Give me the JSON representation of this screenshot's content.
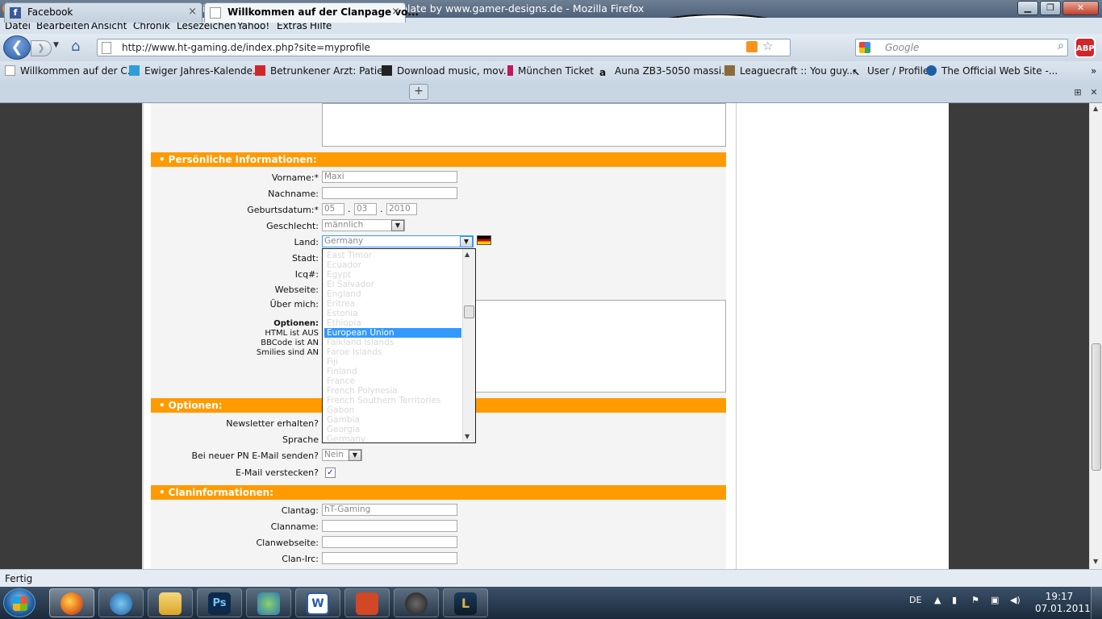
{
  "window": {
    "title": "Willkommen auf der Clanpage von High Times - Konto bearbeiten - ClanTemplate by www.gamer-designs.de - Mozilla Firefox",
    "min": "0",
    "max": "1",
    "close": "r"
  },
  "menu": [
    "Datei",
    "Bearbeiten",
    "Ansicht",
    "Chronik",
    "Lesezeichen",
    "Yahoo!",
    "Extras",
    "Hilfe"
  ],
  "nav": {
    "url": "http://www.ht-gaming.de/index.php?site=myprofile",
    "search_placeholder": "Google",
    "abp_label": "ABP"
  },
  "bookmarks": [
    "Willkommen auf der C...",
    "Ewiger Jahres-Kalende...",
    "Betrunkener Arzt: Patie...",
    "Download music, mov...",
    "München Ticket",
    "Auna ZB3-5050 massi...",
    "Leaguecraft :: You guy...",
    "User / Profile",
    "The Official Web Site -..."
  ],
  "tabs": [
    {
      "label": "Facebook",
      "close": "×"
    },
    {
      "label": "Willkommen auf der Clanpage vo...",
      "close": "×"
    }
  ],
  "newtab": "+",
  "form": {
    "sections": {
      "personal": "Persönliche Informationen:",
      "options": "Optionen:",
      "clan": "Claninformationen:"
    },
    "labels": {
      "vorname": "Vorname:*",
      "nachname": "Nachname:",
      "geburtsdatum": "Geburtsdatum:*",
      "geschlecht": "Geschlecht:",
      "land": "Land:",
      "stadt": "Stadt:",
      "icq": "Icq#:",
      "webseite": "Webseite:",
      "uebermich": "Über mich:",
      "optionen": "Optionen:",
      "html": "HTML ist AUS",
      "bbcode": "BBCode ist AN",
      "smilies": "Smilies sind AN",
      "newsletter": "Newsletter erhalten?",
      "sprache": "Sprache",
      "pn_mail": "Bei neuer PN E-Mail senden?",
      "mail_hide": "E-Mail verstecken?",
      "clantag": "Clantag:",
      "clanname": "Clanname:",
      "clanwebseite": "Clanwebseite:",
      "clanirc": "Clan-Irc:"
    },
    "values": {
      "vorname": "Maxi",
      "day": "05",
      "month": "03",
      "year": "2010",
      "date_sep": ".",
      "geschlecht": "männlich",
      "land": "Germany",
      "pn_mail": "Nein",
      "mail_hide_checked": "✓",
      "clantag": "hT-Gaming"
    },
    "country_list": [
      "East Timor",
      "Ecuador",
      "Egypt",
      "El Salvador",
      "England",
      "Eritrea",
      "Estonia",
      "Ethiopia",
      "European Union",
      "Falkland Islands",
      "Faroe Islands",
      "Fiji",
      "Finland",
      "France",
      "French Polynesia",
      "French Southern Territories",
      "Gabon",
      "Gambia",
      "Georgia",
      "Germany"
    ],
    "selected_country": "European Union"
  },
  "status": "Fertig",
  "tray": {
    "lang": "DE",
    "time": "19:17",
    "date": "07.01.2011"
  },
  "colors": {
    "section_orange": "#ff9a00",
    "selection_blue": "#3399ff"
  }
}
